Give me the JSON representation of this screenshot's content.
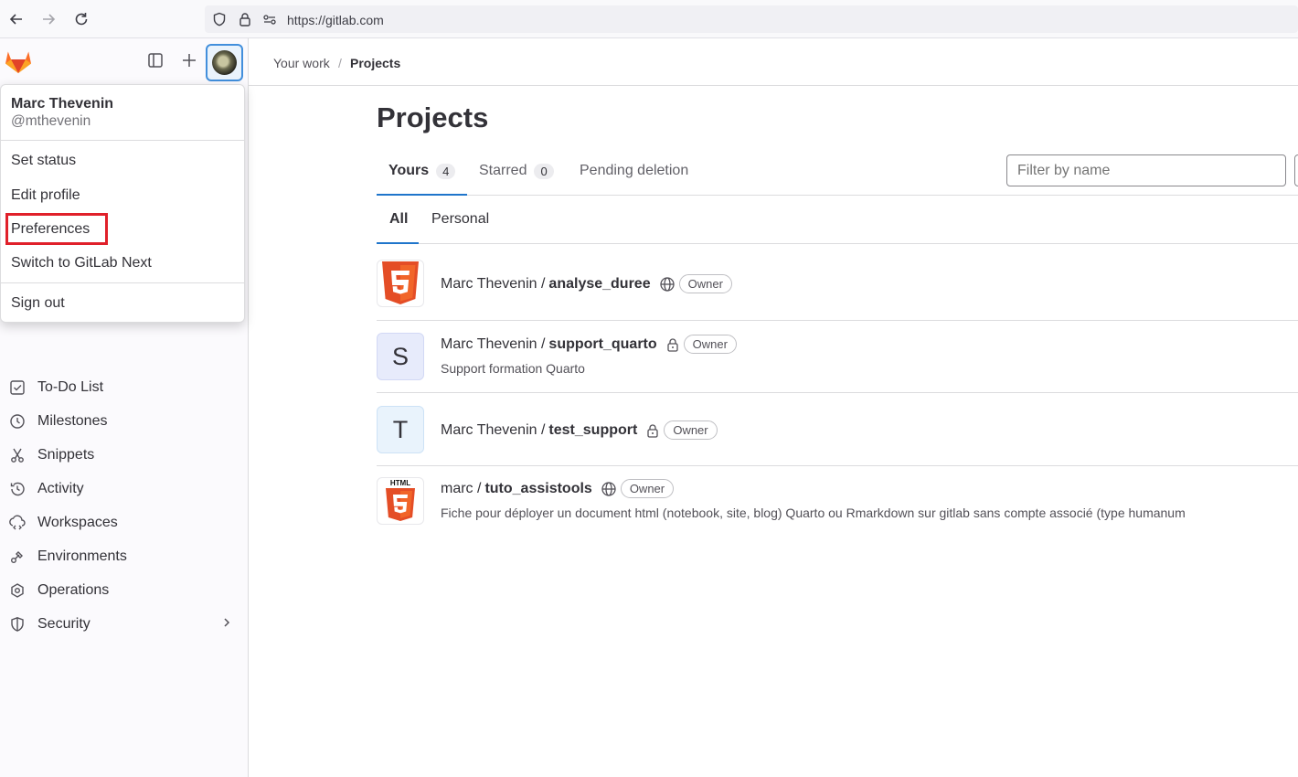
{
  "browser": {
    "url": "https://gitlab.com"
  },
  "breadcrumb": {
    "parent": "Your work",
    "separator": "/",
    "current": "Projects"
  },
  "user_menu": {
    "name": "Marc Thevenin",
    "handle": "@mthevenin",
    "items": [
      "Set status",
      "Edit profile",
      "Preferences",
      "Switch to GitLab Next",
      "Sign out"
    ]
  },
  "sidebar": {
    "items": [
      {
        "label": "To-Do List",
        "icon": "todo-icon"
      },
      {
        "label": "Milestones",
        "icon": "clock-icon"
      },
      {
        "label": "Snippets",
        "icon": "snippet-icon"
      },
      {
        "label": "Activity",
        "icon": "history-icon"
      },
      {
        "label": "Workspaces",
        "icon": "workspace-icon"
      },
      {
        "label": "Environments",
        "icon": "environment-icon"
      },
      {
        "label": "Operations",
        "icon": "deployments-icon"
      },
      {
        "label": "Security",
        "icon": "shield-icon"
      }
    ]
  },
  "page": {
    "title": "Projects",
    "tabs": [
      {
        "label": "Yours",
        "count": "4"
      },
      {
        "label": "Starred",
        "count": "0"
      },
      {
        "label": "Pending deletion"
      }
    ],
    "filter_placeholder": "Filter by name",
    "subtabs": [
      "All",
      "Personal"
    ]
  },
  "projects": [
    {
      "namespace": "Marc Thevenin /",
      "name": "analyse_duree",
      "visibility": "public",
      "role": "Owner",
      "description": "",
      "avatar": "html5-logo"
    },
    {
      "namespace": "Marc Thevenin /",
      "name": "support_quarto",
      "visibility": "private",
      "role": "Owner",
      "description": "Support formation Quarto",
      "avatar": "S"
    },
    {
      "namespace": "Marc Thevenin /",
      "name": "test_support",
      "visibility": "private",
      "role": "Owner",
      "description": "",
      "avatar": "T"
    },
    {
      "namespace": "marc /",
      "name": "tuto_assistools",
      "visibility": "public",
      "role": "Owner",
      "description": "Fiche pour déployer un document html (notebook, site, blog) Quarto ou Rmarkdown sur gitlab sans compte associé (type humanum",
      "avatar": "html5-logo-with-label",
      "avatar_label": "HTML"
    }
  ],
  "colors": {
    "accent": "#1f75cb",
    "highlight": "#e0202a",
    "html5": "#e44d26"
  }
}
